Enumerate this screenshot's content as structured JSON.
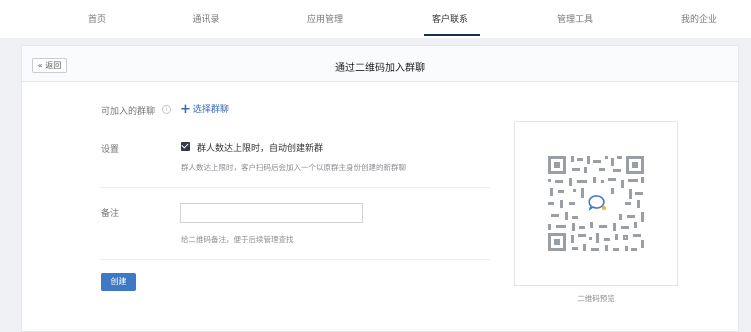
{
  "nav": {
    "items": [
      {
        "label": "首页"
      },
      {
        "label": "通讯录"
      },
      {
        "label": "应用管理"
      },
      {
        "label": "客户联系"
      },
      {
        "label": "管理工具"
      },
      {
        "label": "我的企业"
      }
    ],
    "active_index": 3
  },
  "page": {
    "back_label": "« 返回",
    "title": "通过二维码加入群聊"
  },
  "form": {
    "groups_label": "可加入的群聊",
    "add_group_label": "选择群聊",
    "settings_label": "设置",
    "auto_create_label": "群人数达上限时，自动创建新群",
    "auto_create_checked": true,
    "auto_create_hint": "群人数达上限时，客户扫码后会加入一个以原群主身份创建的新群聊",
    "remark_label": "备注",
    "remark_value": "",
    "remark_hint": "给二维码备注，便于后续管理查找",
    "create_label": "创建"
  },
  "qr": {
    "caption": "二维码预览"
  },
  "icons": {
    "info": "info-icon",
    "plus": "plus-icon",
    "checkbox": "checkbox-checked-icon",
    "qr": "qr-code-icon",
    "chat_bubble": "chat-bubble-icon"
  },
  "colors": {
    "accent": "#3f78c5",
    "link": "#3a6bb0",
    "nav_underline": "#1a2e52",
    "background": "#eef0f3"
  }
}
